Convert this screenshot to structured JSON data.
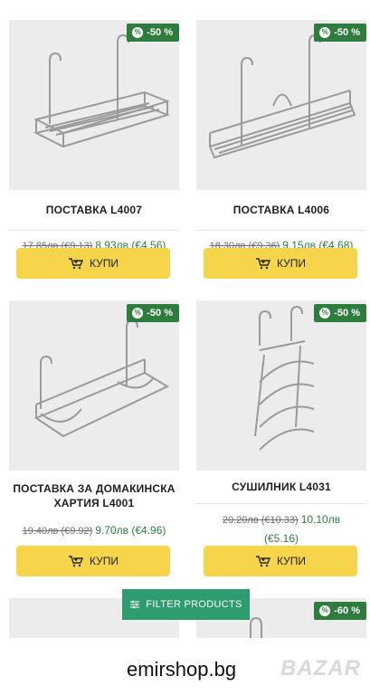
{
  "products": [
    {
      "title": "ПОСТАВКА L4007",
      "badge": "-50 %",
      "old_price": "17.85лв (€9.13)",
      "new_price": "8.93лв (€4.56)",
      "buy_label": "КУПИ"
    },
    {
      "title": "ПОСТАВКА L4006",
      "badge": "-50 %",
      "old_price": "18.30лв (€9.36)",
      "new_price": "9.15лв (€4.68)",
      "buy_label": "КУПИ"
    },
    {
      "title": "ПОСТАВКА ЗА ДОМАКИНСКА ХАРТИЯ L4001",
      "badge": "-50 %",
      "old_price": "19.40лв (€9.92)",
      "new_price": "9.70лв (€4.96)",
      "buy_label": "КУПИ"
    },
    {
      "title": "СУШИЛНИК L4031",
      "badge": "-50 %",
      "old_price": "20.20лв (€10.33)",
      "new_price": "10.10лв (€5.16)",
      "buy_label": "КУПИ"
    },
    {
      "badge": "-60 %"
    }
  ],
  "filter_label": "FILTER PRODUCTS",
  "watermark": {
    "site": "emirshop.bg",
    "logo": "BAZAR"
  },
  "icons": {
    "cart": "cart-icon",
    "filter": "sliders-icon",
    "discount": "percent-icon"
  },
  "colors": {
    "badge": "#2e7d3f",
    "buy": "#f7d54a",
    "filter": "#2e9c6e"
  }
}
